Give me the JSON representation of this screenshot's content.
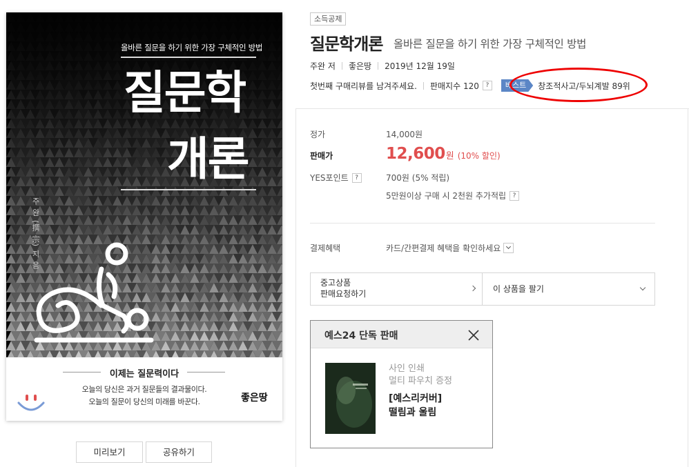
{
  "cover": {
    "subtitle": "올바른 질문을 하기 위한 가장 구체적인 방법",
    "title_line1": "질문학",
    "title_line2": "개론",
    "author_vertical": "주 완 (撰 宗) 지 음",
    "tagline": "이제는 질문력이다",
    "desc_line1": "오늘의 당신은 과거 질문들의 결과물이다.",
    "desc_line2": "오늘의 질문이 당신의 미래를 바꾼다.",
    "publisher": "좋은땅"
  },
  "buttons": {
    "preview": "미리보기",
    "share": "공유하기"
  },
  "product": {
    "badge": "소득공제",
    "title": "질문학개론",
    "subtitle": "올바른 질문을 하기 위한 가장 구체적인 방법",
    "author": "주완 저",
    "publisher": "좋은땅",
    "date": "2019년 12월 19일",
    "review_prompt": "첫번째 구매리뷰를 남겨주세요.",
    "sales_index": "판매지수 120",
    "help_mark": "?",
    "best_tag": "베스트",
    "best_category": "창조적사고/두뇌계발 89위"
  },
  "price": {
    "list_label": "정가",
    "list_value": "14,000원",
    "sale_label": "판매가",
    "sale_value": "12,600",
    "sale_unit": "원",
    "discount": "(10% 할인)",
    "points_label": "YES포인트",
    "points_value": "700원 (5% 적립)",
    "extra_points": "5만원이상 구매 시 2천원 추가적립"
  },
  "benefit": {
    "label": "결제혜택",
    "value": "카드/간편결제 혜택을 확인하세요"
  },
  "used": {
    "left_line1": "중고상품",
    "left_line2": "판매요청하기",
    "right": "이 상품을 팔기"
  },
  "promo": {
    "header": "예스24 단독 판매",
    "line1": "사인 인쇄",
    "line2": "멀티 파우치 증정",
    "line3": "[예스리커버]",
    "line4": "떨림과 울림"
  },
  "colors": {
    "accent_price": "#e04e4e",
    "best_tag": "#5b86c6",
    "annotation_oval": "#e00000"
  }
}
